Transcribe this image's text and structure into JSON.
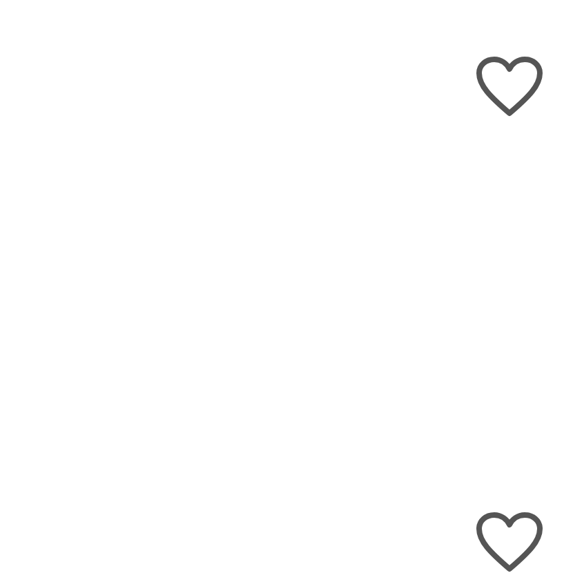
{
  "posts": [
    {
      "liked": false
    },
    {
      "liked": false
    }
  ]
}
